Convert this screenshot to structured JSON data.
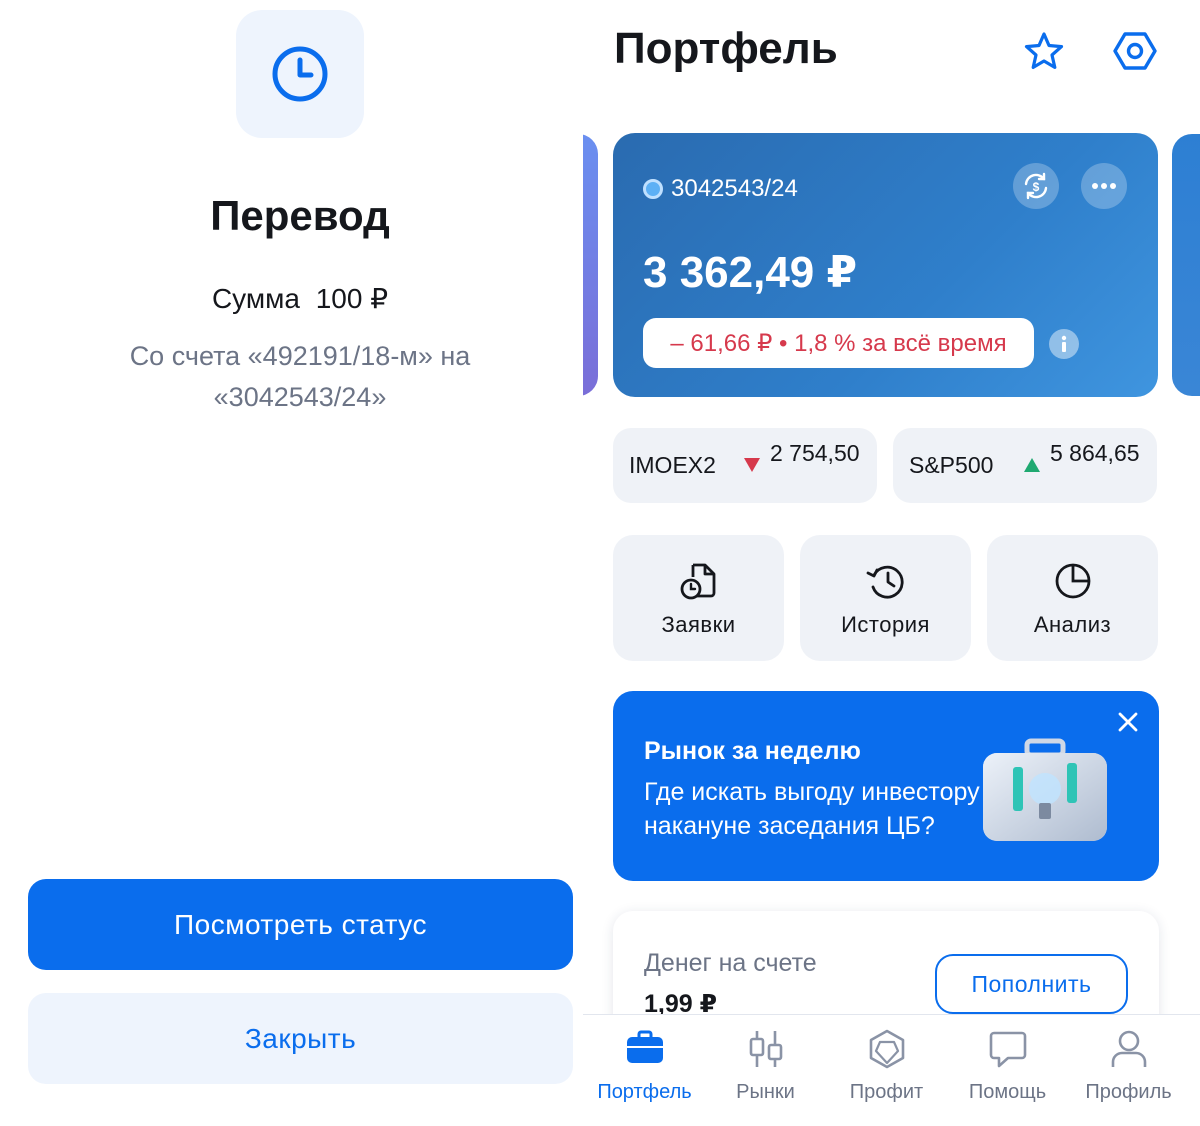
{
  "left_panel": {
    "title": "Перевод",
    "sum_label": "Сумма",
    "sum_value": "100 ₽",
    "description": "Со счета «492191/18-м» на «3042543/24»",
    "primary_button": "Посмотреть статус",
    "secondary_button": "Закрыть"
  },
  "portfolio": {
    "title": "Портфель",
    "account": {
      "id": "3042543/24",
      "amount": "3 362,49 ₽",
      "change": "– 61,66 ₽ • 1,8 % за всё время"
    },
    "indices": [
      {
        "name": "IMOEX2",
        "value": "2 754,50",
        "direction": "down"
      },
      {
        "name": "S&P500",
        "value": "5 864,65",
        "direction": "up"
      }
    ],
    "actions": [
      {
        "label": "Заявки",
        "icon": "orders-icon"
      },
      {
        "label": "История",
        "icon": "history-icon"
      },
      {
        "label": "Анализ",
        "icon": "pie-chart-icon"
      }
    ],
    "promo": {
      "title": "Рынок за неделю",
      "text": "Где искать выгоду инвестору накануне заседания ЦБ?"
    },
    "money": {
      "label": "Денег на счете",
      "value": "1,99 ₽",
      "button": "Пополнить"
    },
    "tabs": [
      {
        "label": "Портфель",
        "icon": "briefcase-icon",
        "active": true
      },
      {
        "label": "Рынки",
        "icon": "candles-icon",
        "active": false
      },
      {
        "label": "Профит",
        "icon": "profit-icon",
        "active": false
      },
      {
        "label": "Помощь",
        "icon": "chat-icon",
        "active": false
      },
      {
        "label": "Профиль",
        "icon": "person-icon",
        "active": false
      }
    ]
  },
  "colors": {
    "accent": "#0a6ded",
    "negative": "#d6394c",
    "positive": "#1fa971",
    "card_gradient_start": "#2a6bb0",
    "tile_bg": "#eff2f7"
  }
}
